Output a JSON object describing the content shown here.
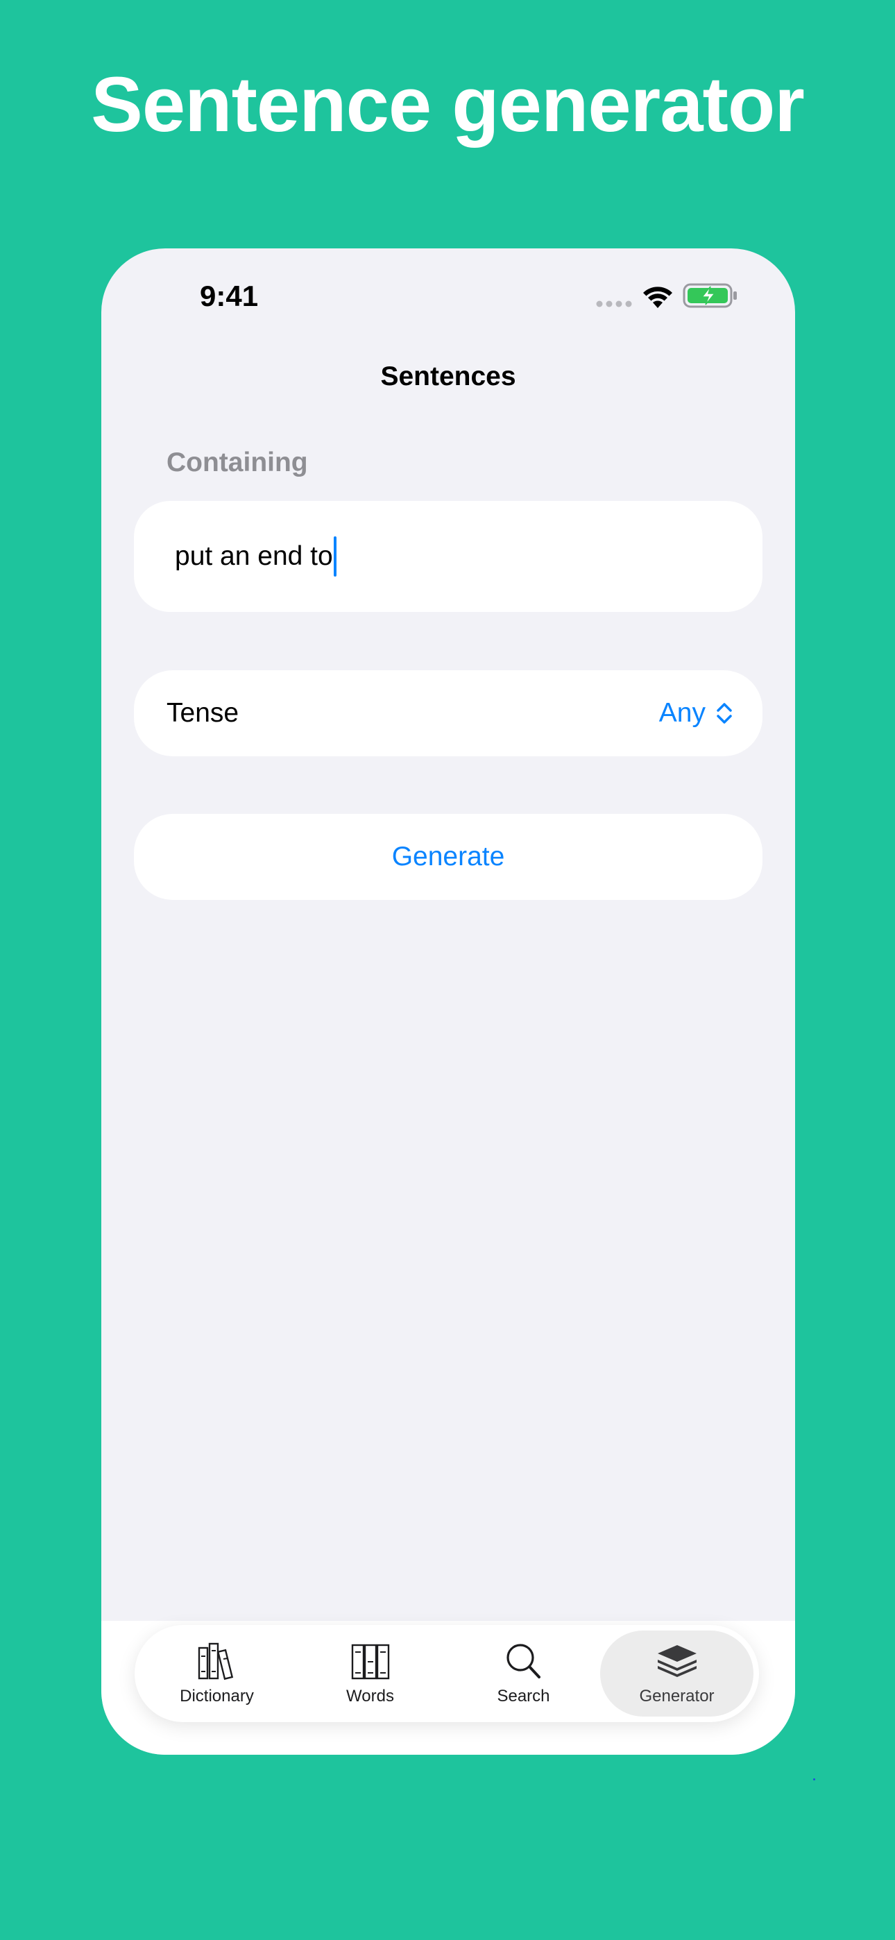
{
  "headline": "Sentence generator",
  "status_bar": {
    "time": "9:41",
    "icons": [
      "signal-dots-icon",
      "wifi-icon",
      "battery-charging-icon"
    ]
  },
  "screen": {
    "title": "Sentences",
    "containing_label": "Containing",
    "containing_value": "put an end to",
    "tense_label": "Tense",
    "tense_value": "Any",
    "generate_label": "Generate"
  },
  "tab_bar": {
    "active": "Generator",
    "items": [
      {
        "label": "Dictionary",
        "icon": "books-icon"
      },
      {
        "label": "Words",
        "icon": "binders-icon"
      },
      {
        "label": "Search",
        "icon": "magnifier-icon"
      },
      {
        "label": "Generator",
        "icon": "stack-icon"
      }
    ]
  },
  "colors": {
    "background": "#1ec49d",
    "accent": "#0a84ff",
    "battery": "#34c759",
    "screen_bg": "#f2f2f7"
  }
}
